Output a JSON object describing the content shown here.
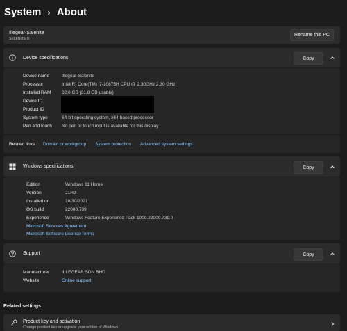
{
  "breadcrumb": {
    "parent": "System",
    "separator": "›",
    "current": "About"
  },
  "pc": {
    "name": "Illegear-Salenite",
    "model": "SELENITE G",
    "rename_label": "Rename this PC"
  },
  "device_specs": {
    "title": "Device specifications",
    "copy_label": "Copy",
    "rows": [
      {
        "label": "Device name",
        "value": "Illegear-Salenite"
      },
      {
        "label": "Processor",
        "value": "Intel(R) Core(TM) i7-10875H CPU @ 2.30GHz   2.30 GHz"
      },
      {
        "label": "Installed RAM",
        "value": "32.0 GB (31.8 GB usable)"
      },
      {
        "label": "Device ID",
        "value": ""
      },
      {
        "label": "Product ID",
        "value": ""
      },
      {
        "label": "System type",
        "value": "64-bit operating system, x64-based processor"
      },
      {
        "label": "Pen and touch",
        "value": "No pen or touch input is available for this display"
      }
    ]
  },
  "related_links": {
    "label": "Related links",
    "items": [
      "Domain or workgroup",
      "System protection",
      "Advanced system settings"
    ]
  },
  "windows_specs": {
    "title": "Windows specifications",
    "copy_label": "Copy",
    "rows": [
      {
        "label": "Edition",
        "value": "Windows 11 Home"
      },
      {
        "label": "Version",
        "value": "21H2"
      },
      {
        "label": "Installed on",
        "value": "10/30/2021"
      },
      {
        "label": "OS build",
        "value": "22000.739"
      },
      {
        "label": "Experience",
        "value": "Windows Feature Experience Pack 1000.22000.739.0"
      }
    ],
    "links": [
      "Microsoft Services Agreement",
      "Microsoft Software License Terms"
    ]
  },
  "support": {
    "title": "Support",
    "copy_label": "Copy",
    "rows": [
      {
        "label": "Manufacturer",
        "value": "ILLEGEAR SDN BHD"
      },
      {
        "label": "Website",
        "value": "Online support"
      }
    ]
  },
  "related_settings": {
    "label": "Related settings",
    "item_title": "Product key and activation",
    "item_sub": "Change product key or upgrade your edition of Windows"
  },
  "colors": {
    "background": "#1c1c1c",
    "card": "#2b2b2b",
    "link": "#8fc7ff"
  }
}
